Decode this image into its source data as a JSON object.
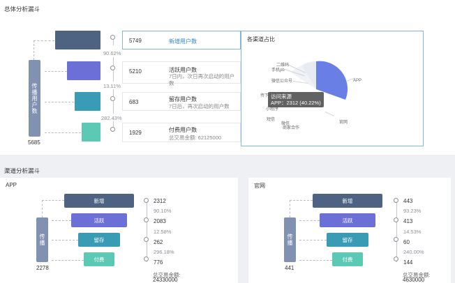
{
  "overall": {
    "title": "总体分析漏斗",
    "side_label": "传播用户数",
    "side_value": "5685",
    "pcts": [
      "90.62%",
      "13.11%",
      "282.43%"
    ],
    "rows": [
      {
        "value": "5749",
        "name": "新增用户数",
        "desc": ""
      },
      {
        "value": "5210",
        "name": "活跃用户数",
        "desc": "7日内，次日再次启动的用户数"
      },
      {
        "value": "683",
        "name": "留存用户数",
        "desc": "7日后，再次启动的用户数"
      },
      {
        "value": "1929",
        "name": "付费用户数",
        "desc": "总交易金额:  62125000"
      }
    ]
  },
  "channel_share": {
    "title": "各渠道占比",
    "labels": [
      "二维码",
      "手机pb",
      "微信公众号",
      "传下",
      "小程序",
      "短信",
      "微信",
      "商家合作",
      "APP",
      "官网"
    ],
    "tooltip": {
      "title": "访问来源",
      "text": "APP：2312 (40.22%)"
    }
  },
  "channel_funnel": {
    "title": "渠道分析漏斗",
    "panels": [
      {
        "name": "APP",
        "side_label": "传播",
        "side_value": "2278",
        "stages": [
          "新增",
          "活跃",
          "留存",
          "付费"
        ],
        "values": [
          "2312",
          "2083",
          "262",
          "776"
        ],
        "pcts": [
          "90.10%",
          "12.58%",
          "296.18%"
        ],
        "total_label": "总交易金额:",
        "total_value": "24330000"
      },
      {
        "name": "官网",
        "side_label": "传播",
        "side_value": "441",
        "stages": [
          "新增",
          "活跃",
          "留存",
          "付费"
        ],
        "values": [
          "443",
          "413",
          "60",
          "144"
        ],
        "pcts": [
          "93.23%",
          "14.53%",
          "240.00%"
        ],
        "total_label": "总交易金额:",
        "total_value": "4630000"
      }
    ]
  },
  "colors": {
    "s1": "#4e6282",
    "s2": "#6c6fd6",
    "s3": "#3a9bb5",
    "s4": "#5cc9b4",
    "side": "#8191b2",
    "accent": "#2f86d6",
    "pie": "#6a7fe6"
  }
}
